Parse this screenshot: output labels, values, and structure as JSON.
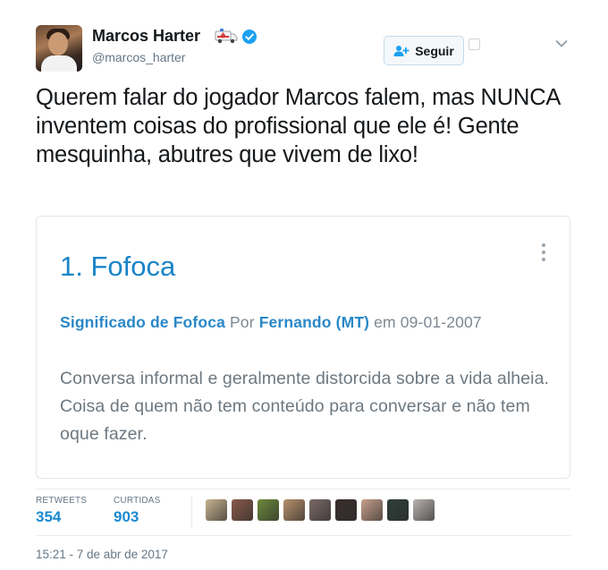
{
  "author": {
    "name": "Marcos Harter",
    "handle": "@marcos_harter",
    "name_emoji": "ambulance-icon",
    "verified": true
  },
  "follow_button": {
    "label": "Seguir",
    "icon": "add-person-icon"
  },
  "tweet": {
    "text": "Querem falar do jogador Marcos falem, mas NUNCA inventem coisas do profissional que ele é! Gente mesquinha, abutres que vivem de lixo!"
  },
  "card": {
    "title": "1. Fofoca",
    "meta": {
      "prefix_link": "Significado de Fofoca",
      "by": "Por",
      "author_link": "Fernando (MT)",
      "date_text": "em 09-01-2007"
    },
    "definition_line1": "Conversa informal e geralmente distorcida sobre a vida alheia.",
    "definition_line2": "Coisa de quem não tem conteúdo para conversar e não tem oque fazer."
  },
  "stats": {
    "retweets_label": "RETWEETS",
    "retweets_value": "354",
    "likes_label": "CURTIDAS",
    "likes_value": "903"
  },
  "likers": [
    {
      "color": "#c8b38f"
    },
    {
      "color": "#8a5a4a"
    },
    {
      "color": "#6d8a3c"
    },
    {
      "color": "#b7906a"
    },
    {
      "color": "#7a6a66"
    },
    {
      "color": "#3a2f2d"
    },
    {
      "color": "#c9a08a"
    },
    {
      "color": "#2f3f3a"
    },
    {
      "color": "#b9b3b0"
    }
  ],
  "timestamp": "15:21 - 7 de abr de 2017",
  "colors": {
    "link_blue": "#1a84c7",
    "stat_blue": "#1b8ad0",
    "verified_blue": "#1da1f2",
    "muted_gray": "#657786"
  }
}
